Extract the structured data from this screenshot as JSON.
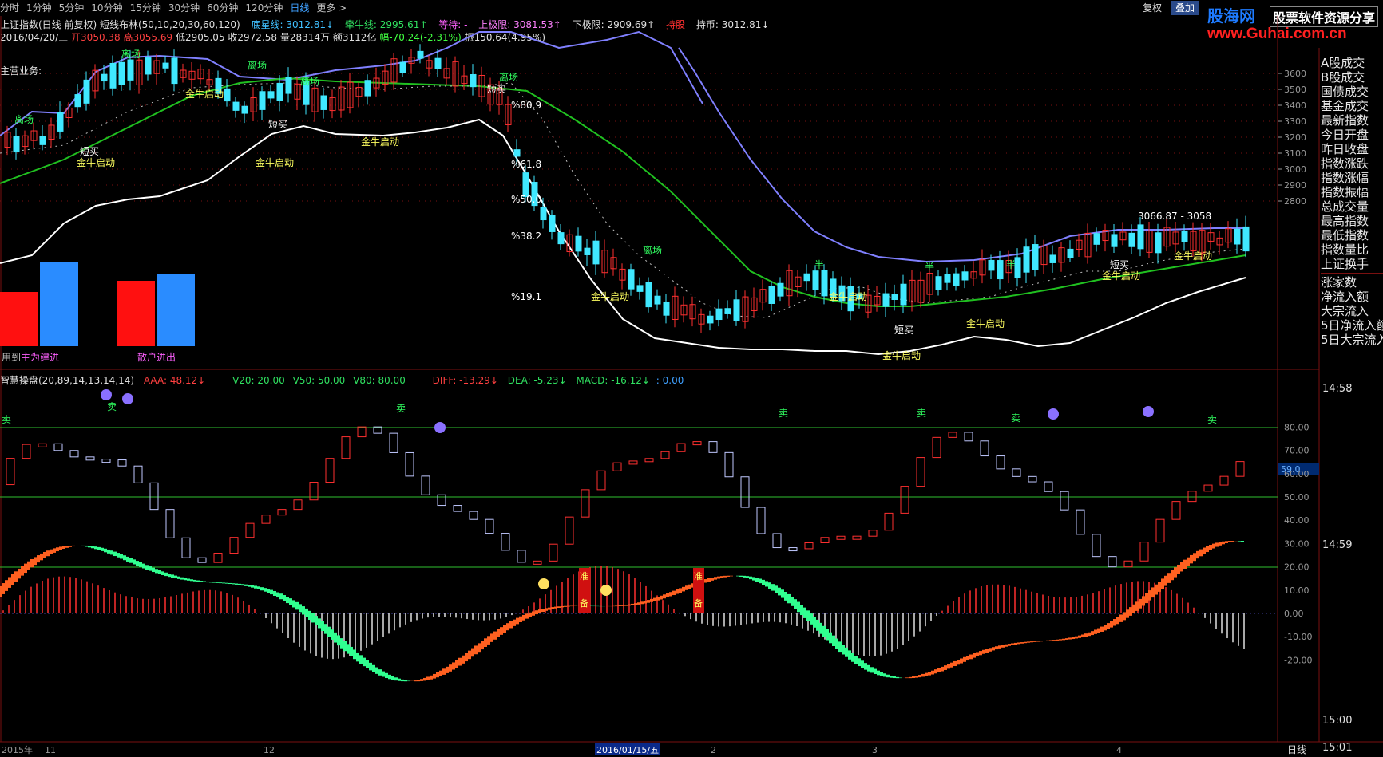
{
  "timeframes": [
    "分时",
    "1分钟",
    "5分钟",
    "10分钟",
    "15分钟",
    "30分钟",
    "60分钟",
    "120分钟",
    "日线",
    "更多 >"
  ],
  "active_timeframe": "日线",
  "top_buttons": {
    "restore": "复权",
    "overlay": "叠加"
  },
  "logo": {
    "brand": "股海网",
    "slogan": "股票软件资源分享",
    "url": "www.Guhai.com.cn"
  },
  "title_line": {
    "name": "上证指数(日线 前复权) 短线布林(50,10,20,30,60,120)",
    "bottom_line": "底星线: 3012.81↓",
    "bull_line": "牵牛线: 2995.61↑",
    "wait": "等待: -",
    "upper": "上极限: 3081.53↑",
    "lower": "下极限: 2909.69↑",
    "hold_label": "持股",
    "hold_coin": "持币: 3012.81↓"
  },
  "ohlc_line": {
    "date": "2016/04/20/三",
    "open": "开3050.38",
    "high": "高3055.69",
    "low": "低2905.05",
    "close": "收2972.58",
    "volume": "量28314万",
    "amount": "额3112亿",
    "change": "幅-70.24(-2.31%)",
    "amplitude": "振150.64(4.95%)"
  },
  "main_business_label": "主营业务:",
  "fib_levels": [
    "%80.9",
    "%61.8",
    "%50.0",
    "%38.2",
    "%19.1"
  ],
  "price_axis": [
    "3600",
    "3500",
    "3400",
    "3300",
    "3200",
    "3100",
    "3000",
    "2900",
    "2800"
  ],
  "price_marker": "3066.87 - 3058",
  "small_bars": {
    "left_label_a": "用到",
    "left_label_b": "主为建进",
    "right_label": "散户进出"
  },
  "indicator_line": {
    "name": "智慧操盘(20,89,14,13,14,14)",
    "aaa": "AAA: 48.12↓",
    "v20": "V20: 20.00",
    "v50": "V50: 50.00",
    "v80": "V80: 80.00",
    "diff": "DIFF: -13.29↓",
    "dea": "DEA: -5.23↓",
    "macd": "MACD: -16.12↓",
    "colon": ": 0.00"
  },
  "lower_axis": [
    "80.00",
    "70.00",
    "60.00",
    "50.00",
    "40.00",
    "30.00",
    "20.00",
    "10.00",
    "0.00",
    "-10.00",
    "-20.00"
  ],
  "current_value_badge": "59.0",
  "signal_labels": {
    "sell": "卖",
    "leave": "离场",
    "short_buy": "短买",
    "bull_start": "金牛启动",
    "half": "半",
    "prep_a": "准",
    "prep_b": "备"
  },
  "time_axis": [
    "2015年",
    "11",
    "12",
    "2016/01/15/五",
    "2",
    "3",
    "4"
  ],
  "bottom_right": "日线",
  "right_list": [
    "A股成交",
    "B股成交",
    "国债成交",
    "基金成交",
    "最新指数",
    "今日开盘",
    "昨日收盘",
    "指数涨跌",
    "指数涨幅",
    "指数振幅",
    "总成交量",
    "最高指数",
    "最低指数",
    "指数量比",
    "上证换手",
    "涨家数",
    "净流入额",
    "大宗流入",
    "5日净流入额",
    "5日大宗流入"
  ],
  "right_times": [
    "14:58",
    "14:59",
    "15:00",
    "15:01"
  ],
  "colors": {
    "up": "#ff3030",
    "down": "#40e8ff",
    "grid": "#7a1010",
    "green_line": "#20c020",
    "blue_line": "#8080ff",
    "accent_blue": "#3fa0ff"
  }
}
